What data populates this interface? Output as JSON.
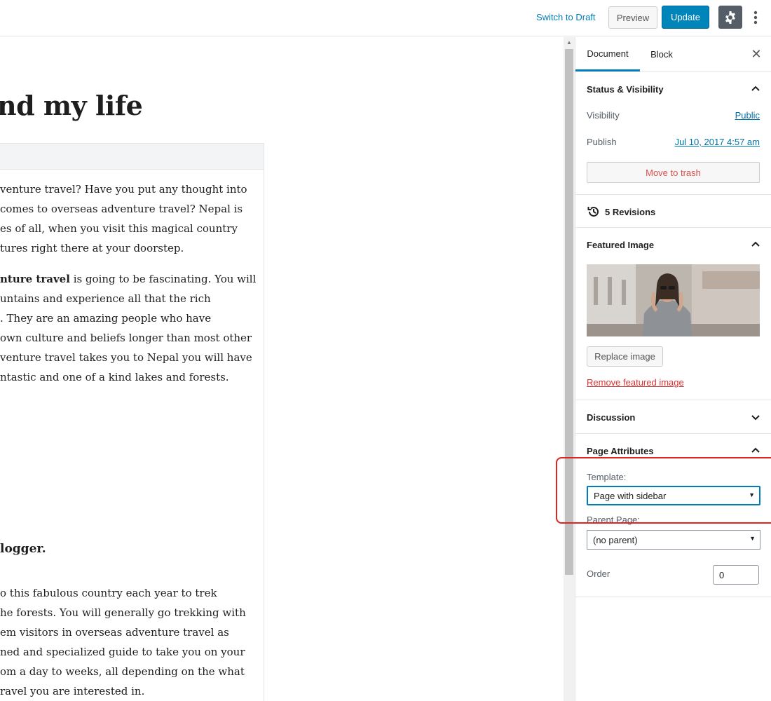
{
  "header": {
    "switch_to_draft": "Switch to Draft",
    "preview": "Preview",
    "update": "Update"
  },
  "editor": {
    "title": "nd my life",
    "paragraph1": "venture travel? Have you put any thought into\ncomes to overseas adventure travel? Nepal is\nes of all, when you visit this magical country\ntures right there at your doorstep.",
    "paragraph2_bold": "nture travel",
    "paragraph2_rest": " is going to be fascinating. You will",
    "paragraph2_more": "untains and experience all that the rich\n. They are an amazing people who have\nown culture and beliefs longer than most other\nventure travel takes you to Nepal you will have\nntastic and one of a kind lakes and forests.",
    "heading": "logger.",
    "paragraph3": "o this fabulous country each year to trek\nhe forests. You will generally go trekking with\nem visitors in overseas adventure travel as\nned and specialized guide to take you on your\nom a day to weeks, all depending on the what\nravel you are interested in."
  },
  "sidebar": {
    "tabs": [
      {
        "label": "Document"
      },
      {
        "label": "Block"
      }
    ],
    "status_visibility": {
      "title": "Status & Visibility",
      "visibility_label": "Visibility",
      "visibility_value": "Public",
      "publish_label": "Publish",
      "publish_value": "Jul 10, 2017 4:57 am",
      "trash_button": "Move to trash"
    },
    "revisions": "5 Revisions",
    "featured_image": {
      "title": "Featured Image",
      "replace_button": "Replace image",
      "remove_link": "Remove featured image"
    },
    "discussion": {
      "title": "Discussion"
    },
    "page_attributes": {
      "title": "Page Attributes",
      "template_label": "Template:",
      "template_value": "Page with sidebar",
      "parent_label": "Parent Page:",
      "parent_value": "(no parent)",
      "order_label": "Order",
      "order_value": "0"
    }
  },
  "colors": {
    "accent": "#007cba",
    "update_button": "#0085ba",
    "highlight": "#e02424",
    "danger": "#dc3232"
  }
}
